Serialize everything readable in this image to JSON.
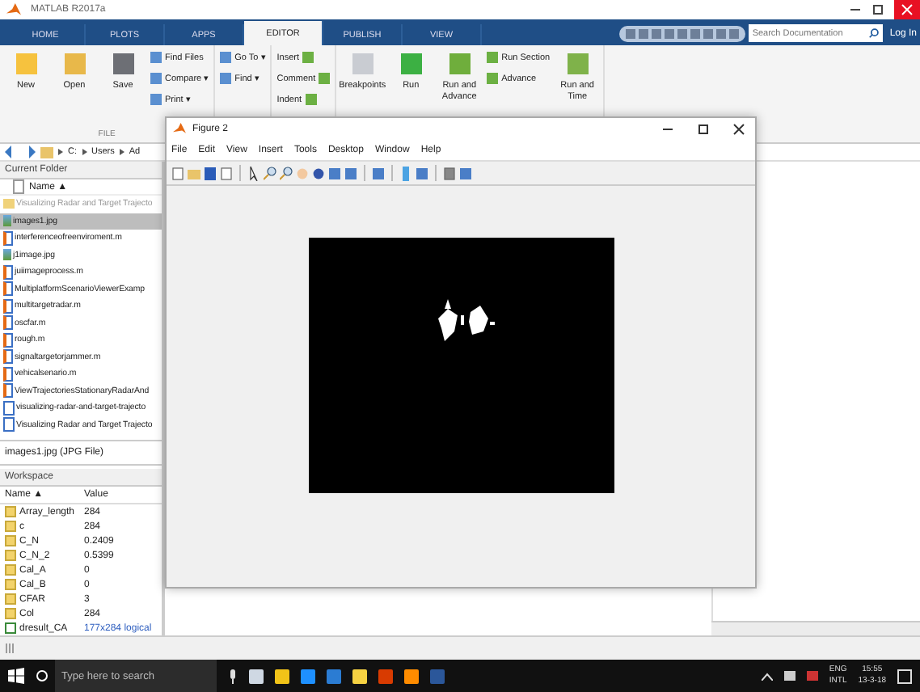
{
  "window": {
    "title": "MATLAB R2017a"
  },
  "tabs": [
    {
      "label": "HOME",
      "selected": false
    },
    {
      "label": "PLOTS",
      "selected": false
    },
    {
      "label": "APPS",
      "selected": false
    },
    {
      "label": "EDITOR",
      "selected": true
    },
    {
      "label": "PUBLISH",
      "selected": false
    },
    {
      "label": "VIEW",
      "selected": false
    }
  ],
  "search": {
    "placeholder": "Search Documentation"
  },
  "login": "Log In",
  "ribbon": {
    "file_buttons": [
      "New",
      "Open",
      "Save"
    ],
    "file_small": [
      "Find Files",
      "Compare ▾",
      "Print ▾"
    ],
    "file_label": "FILE",
    "nav_small": [
      "Go To ▾",
      "Find ▾"
    ],
    "edit_small": [
      "Insert",
      "Comment",
      "Indent"
    ],
    "run_buttons": [
      "Breakpoints",
      "Run",
      "Run and Advance"
    ],
    "section_small": [
      "Run Section",
      "Advance"
    ],
    "time_button": "Run and Time"
  },
  "address": [
    "C:",
    "Users",
    "Ad"
  ],
  "current_folder": {
    "title": "Current Folder",
    "column": "Name ▲",
    "items": [
      {
        "name": "Visualizing Radar and Target Trajecto",
        "kind": "folder",
        "selected": false
      },
      {
        "name": "images1.jpg",
        "selected": true
      },
      {
        "name": "interferenceofreenviroment.m",
        "kind": "script",
        "selected": false
      },
      {
        "name": "j1image.jpg",
        "selected": false
      },
      {
        "name": "juiimageprocess.m",
        "kind": "script",
        "selected": false
      },
      {
        "name": "MultiplatformScenarioViewerExamp",
        "kind": "script",
        "selected": false
      },
      {
        "name": "multitargetradar.m",
        "kind": "script",
        "selected": false
      },
      {
        "name": "oscfar.m",
        "kind": "script",
        "selected": false
      },
      {
        "name": "rough.m",
        "kind": "script",
        "selected": false
      },
      {
        "name": "signaltargetorjammer.m",
        "kind": "script",
        "selected": false
      },
      {
        "name": "vehicalsenario.m",
        "kind": "script",
        "selected": false
      },
      {
        "name": "ViewTrajectoriesStationaryRadarAnd",
        "kind": "script",
        "selected": false
      },
      {
        "name": "visualizing-radar-and-target-trajecto",
        "kind": "live",
        "selected": false
      },
      {
        "name": "Visualizing Radar and Target Trajecto",
        "kind": "live",
        "selected": false
      }
    ],
    "details": "images1.jpg  (JPG File)"
  },
  "workspace": {
    "title": "Workspace",
    "columns": [
      "Name ▲",
      "Value"
    ],
    "rows": [
      {
        "name": "Array_length",
        "value": "284",
        "kind": "number"
      },
      {
        "name": "c",
        "value": "284",
        "kind": "number"
      },
      {
        "name": "C_N",
        "value": "0.2409",
        "kind": "number"
      },
      {
        "name": "C_N_2",
        "value": "0.5399",
        "kind": "number"
      },
      {
        "name": "Cal_A",
        "value": "0",
        "kind": "number"
      },
      {
        "name": "Cal_B",
        "value": "0",
        "kind": "number"
      },
      {
        "name": "CFAR",
        "value": "3",
        "kind": "number"
      },
      {
        "name": "Col",
        "value": "284",
        "kind": "number"
      },
      {
        "name": "dresult_CA",
        "value": "177x284 logical",
        "kind": "logical"
      }
    ]
  },
  "figure": {
    "title": "Figure 2",
    "menu": [
      "File",
      "Edit",
      "View",
      "Insert",
      "Tools",
      "Desktop",
      "Window",
      "Help"
    ]
  },
  "taskbar": {
    "search_placeholder": "Type here to search",
    "language": [
      "ENG",
      "INTL"
    ],
    "time": "15:55",
    "date": "13-3-18"
  }
}
